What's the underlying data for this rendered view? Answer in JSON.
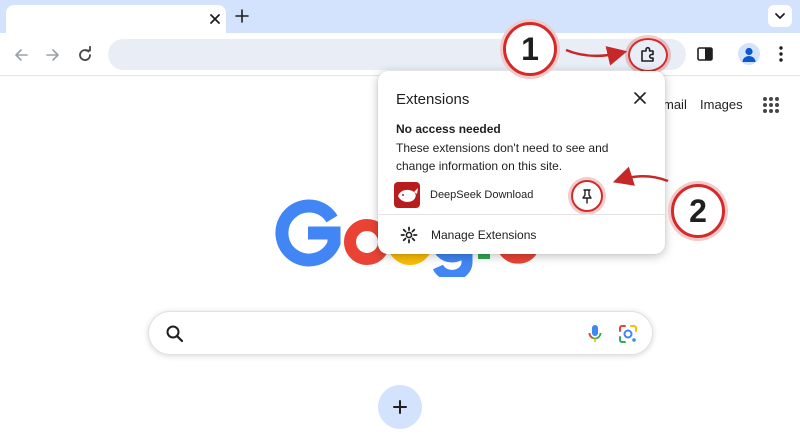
{
  "topbar": {
    "links": [
      "mail",
      "Images"
    ]
  },
  "popup": {
    "title": "Extensions",
    "section_heading": "No access needed",
    "description": "These extensions don't need to see and change information on this site.",
    "extension_name": "DeepSeek Download",
    "manage_label": "Manage Extensions"
  },
  "callouts": {
    "first": "1",
    "second": "2"
  },
  "colors": {
    "tabstrip": "#d3e3fd",
    "omnibox": "#e9eef6",
    "callout_red": "#d42a2a",
    "google_blue": "#4285f4",
    "google_red": "#ea4335",
    "google_yellow": "#fbbc05",
    "google_green": "#34a853"
  },
  "icons": {
    "back": "arrow-left-icon",
    "forward": "arrow-right-icon",
    "reload": "reload-icon",
    "extensions": "puzzle-icon",
    "side_panel": "side-panel-icon",
    "profile": "person-icon",
    "menu": "kebab-icon",
    "apps": "grid-icon",
    "search": "search-icon",
    "voice": "mic-icon",
    "lens": "camera-lens-icon",
    "pin": "pin-icon",
    "settings": "gear-icon",
    "close": "close-icon",
    "add": "plus-icon"
  }
}
